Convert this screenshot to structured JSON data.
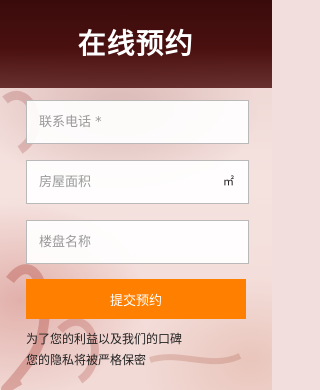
{
  "header": {
    "title": "在线预约"
  },
  "form": {
    "phone_placeholder": "联系电话 *",
    "area_placeholder": "房屋面积",
    "area_unit": "㎡",
    "name_placeholder": "楼盘名称",
    "submit_label": "提交预约"
  },
  "note": {
    "line1": "为了您的利益以及我们的口碑",
    "line2": "您的隐私将被严格保密"
  },
  "colors": {
    "accent": "#ff7f00",
    "header": "#3a0b0b"
  }
}
